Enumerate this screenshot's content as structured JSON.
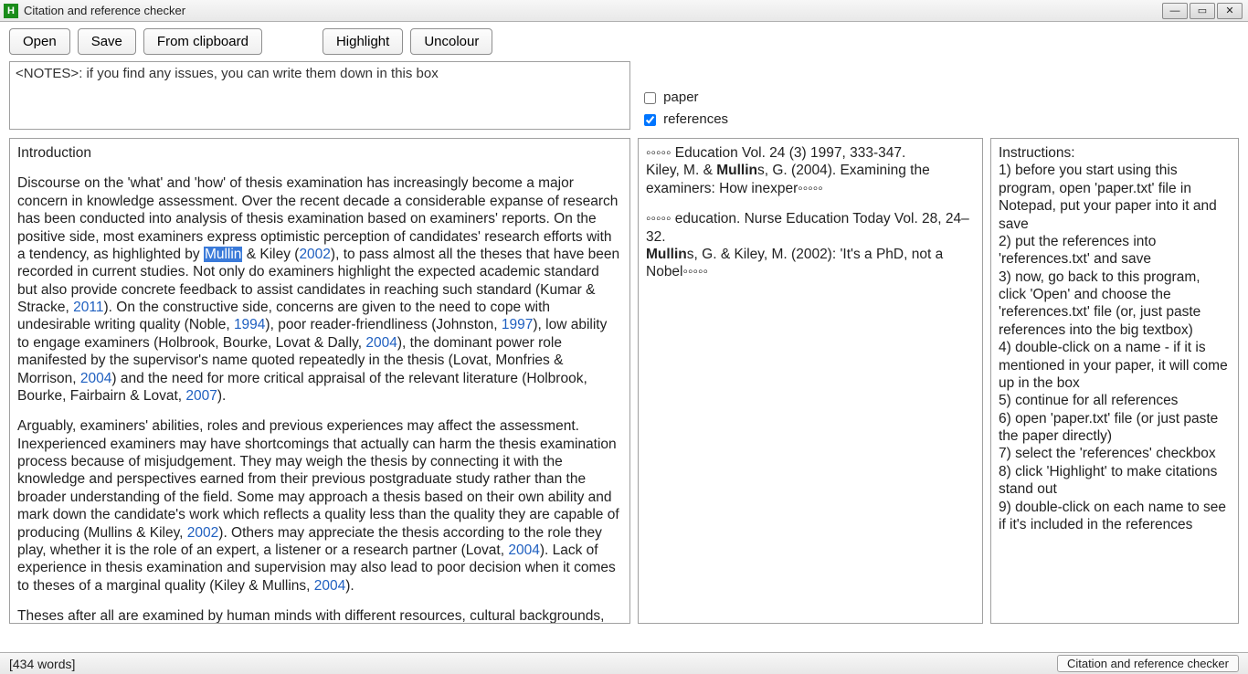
{
  "window": {
    "title": "Citation and reference checker",
    "icon_letter": "H"
  },
  "toolbar": {
    "open": "Open",
    "save": "Save",
    "from_clipboard": "From clipboard",
    "highlight": "Highlight",
    "uncolour": "Uncolour"
  },
  "notes": {
    "placeholder": "<NOTES>: if you find any issues, you can write them down in this box"
  },
  "checks": {
    "paper_label": "paper",
    "paper_checked": false,
    "references_label": "references",
    "references_checked": true
  },
  "paper": {
    "heading": "Introduction",
    "para1_pre": "Discourse on the 'what' and 'how' of thesis examination has increasingly become a major concern in knowledge assessment. Over the recent decade a considerable expanse of research has been conducted into analysis of thesis examination based on examiners' reports. On the positive side, most examiners express optimistic perception of candidates' research efforts with a tendency, as highlighted by ",
    "hl_name": "Mullin",
    "p1_seg1": " & Kiley (",
    "yr1": "2002",
    "p1_seg2": "), to pass almost all the theses that have been recorded in current studies. Not only do examiners highlight the expected academic standard but also provide concrete feedback to assist candidates in reaching such standard (Kumar & Stracke, ",
    "yr2": "2011",
    "p1_seg3": "). On the constructive side, concerns are given to the need to cope with undesirable writing quality (Noble, ",
    "yr3": "1994",
    "p1_seg4": "), poor reader-friendliness (Johnston, ",
    "yr4": "1997",
    "p1_seg5": "), low ability to engage examiners (Holbrook, Bourke, Lovat & Dally, ",
    "yr5": "2004",
    "p1_seg6": "), the dominant power role manifested by the supervisor's name quoted repeatedly in the thesis (Lovat, Monfries & Morrison, ",
    "yr6": "2004",
    "p1_seg7": ") and the need for more critical appraisal of the relevant literature (Holbrook, Bourke, Fairbairn & Lovat, ",
    "yr7": "2007",
    "p1_seg8": ").",
    "para2_pre": "Arguably, examiners' abilities, roles and previous experiences may affect the assessment. Inexperienced examiners may have shortcomings that actually can harm the thesis examination process because of misjudgement. They may weigh the thesis by connecting it with the knowledge and perspectives earned from their previous postgraduate study rather than the broader understanding of the field. Some may approach a thesis based on their own ability and mark down the candidate's work which reflects a quality less than the quality they are capable of producing (Mullins & Kiley, ",
    "yr8": "2002",
    "p2_seg2": "). Others may appreciate the thesis according to the role they play, whether it is the role of an expert, a listener or a research partner (Lovat, ",
    "yr9": "2004",
    "p2_seg3": "). Lack of experience in thesis examination and supervision may also lead to poor decision when it comes to theses of a marginal quality (Kiley & Mullins, ",
    "yr10": "2004",
    "p2_seg4": ").",
    "para3": "Theses after all are examined by human minds with different resources, cultural backgrounds, expertise, priority, abilities, interests, preferences, individual traits, thinking complexity and history"
  },
  "references": {
    "r1": "◦◦◦◦◦ Education Vol. 24 (3) 1997, 333-347.",
    "r2_pre": "Kiley, M. & ",
    "r2_bold": "Mullin",
    "r2_post": "s, G. (2004). Examining the examiners: How inexper◦◦◦◦◦",
    "r3": "◦◦◦◦◦ education. Nurse Education Today Vol. 28, 24–32.",
    "r4_bold": "Mullin",
    "r4_post": "s, G. & Kiley, M. (2002): 'It's a PhD, not a Nobel◦◦◦◦◦"
  },
  "instructions": {
    "heading": "Instructions:",
    "lines": [
      "1) before you start using this program, open 'paper.txt' file in Notepad, put your paper into it and save",
      "2) put the references into 'references.txt' and save",
      "3) now, go back to this program, click 'Open' and choose the 'references.txt' file (or, just paste references into the big textbox)",
      "4) double-click on a name - if it is mentioned in your paper, it will come up in the box",
      "5) continue for all references",
      "6) open 'paper.txt' file (or just paste the paper directly)",
      "7) select the 'references' checkbox",
      "8) click 'Highlight' to make citations stand out",
      "9) double-click on each name to see if it's included in the references"
    ]
  },
  "status": {
    "left": "[434 words]",
    "chip": "Citation and reference checker"
  }
}
